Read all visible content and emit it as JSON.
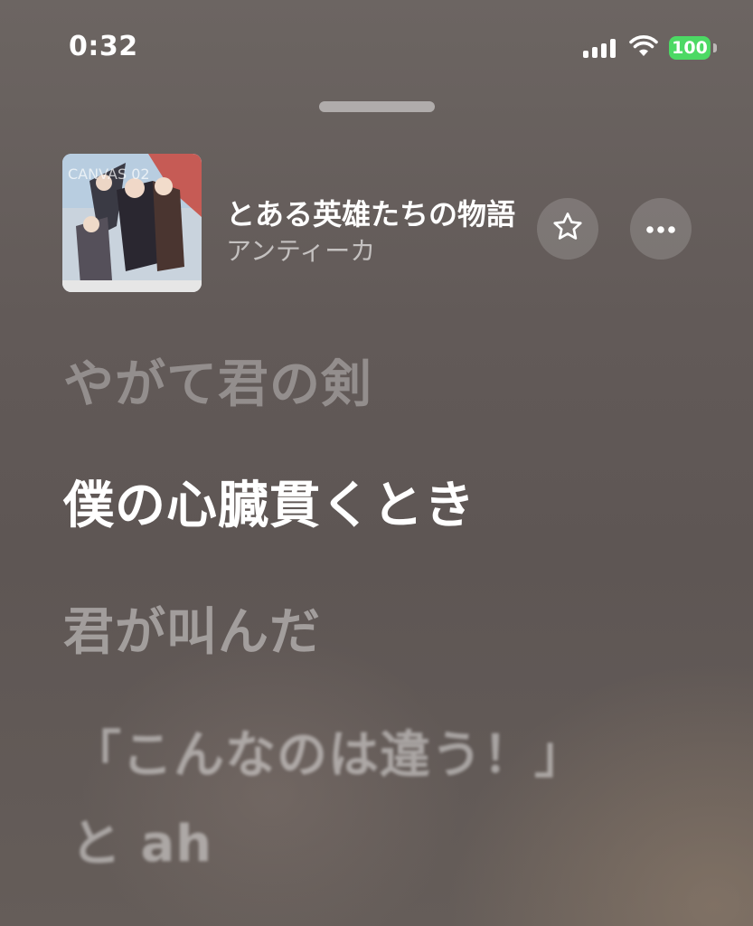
{
  "status_bar": {
    "time": "0:32",
    "battery": "100",
    "battery_color": "#4cd964",
    "icons": [
      "signal-bars-icon",
      "wifi-icon",
      "battery-icon"
    ]
  },
  "now_playing": {
    "title": "とある英雄たちの物語",
    "artist": "アンティーカ",
    "album_art_text": "CANVAS 02",
    "actions": [
      {
        "name": "favorite",
        "icon": "star-outline-icon"
      },
      {
        "name": "more",
        "icon": "ellipsis-icon"
      }
    ]
  },
  "lyrics": {
    "previous": "やがて君の剣",
    "current": "僕の心臓貫くとき",
    "next": [
      "君が叫んだ",
      "「こんなのは違う！」",
      "と ah"
    ]
  }
}
